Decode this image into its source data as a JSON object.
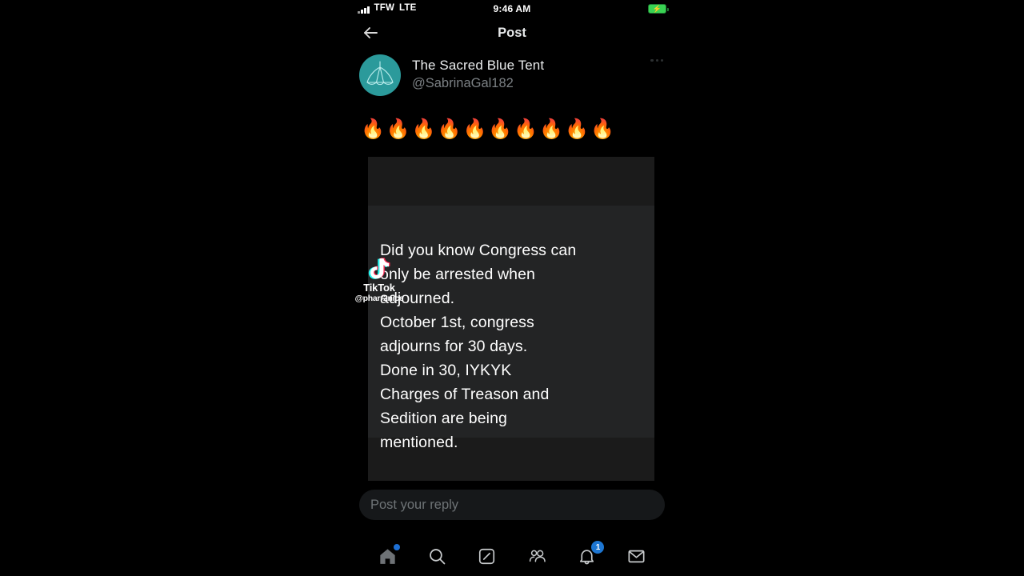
{
  "status_bar": {
    "carrier": "TFW",
    "network": "LTE",
    "time": "9:46 AM",
    "battery_icon": "battery-charging-icon",
    "battery_color": "#39d353"
  },
  "header": {
    "back_icon": "back-arrow-icon",
    "title": "Post"
  },
  "post": {
    "avatar_icon": "tent-avatar-icon",
    "avatar_color": "#2b9a9b",
    "display_name": "The Sacred Blue Tent",
    "handle": "@SabrinaGal182",
    "more_icon": "more-options-icon",
    "text": "🔥🔥🔥🔥🔥🔥🔥🔥🔥🔥"
  },
  "media": {
    "watermark": {
      "brand_icon": "tiktok-note-icon",
      "brand_label": "TikTok",
      "handle": "@pharr2nice"
    },
    "caption_lines": [
      "Did you know Congress can",
      "only be arrested when",
      "adjourned.",
      "October 1st, congress",
      "adjourns for 30 days.",
      "Done in 30, IYKYK",
      "Charges of Treason and",
      "Sedition are being",
      "mentioned."
    ]
  },
  "reply": {
    "placeholder": "Post your reply"
  },
  "bottom_nav": {
    "items": [
      {
        "name": "home",
        "icon": "home-icon",
        "badge": "",
        "badge_type": "dot"
      },
      {
        "name": "search",
        "icon": "search-icon",
        "badge": "",
        "badge_type": "none"
      },
      {
        "name": "grok",
        "icon": "grok-icon",
        "badge": "",
        "badge_type": "none"
      },
      {
        "name": "communities",
        "icon": "communities-icon",
        "badge": "",
        "badge_type": "none"
      },
      {
        "name": "notifications",
        "icon": "bell-icon",
        "badge": "1",
        "badge_type": "count"
      },
      {
        "name": "messages",
        "icon": "envelope-icon",
        "badge": "",
        "badge_type": "none"
      }
    ],
    "accent_color": "#1d76d2"
  }
}
